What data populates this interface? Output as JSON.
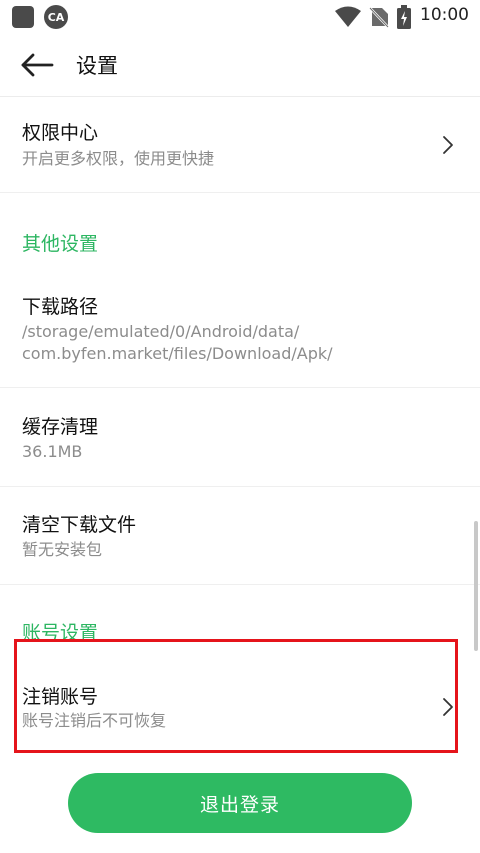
{
  "status_bar": {
    "time": "10:00",
    "left_badge_text": "CA"
  },
  "toolbar": {
    "title": "设置"
  },
  "items": [
    {
      "title": "权限中心",
      "subtitle": "开启更多权限，使用更快捷",
      "has_chevron": true
    },
    {
      "title": "下载路径",
      "subtitle_line1": "/storage/emulated/0/Android/data/",
      "subtitle_line2": "com.byfen.market/files/Download/Apk/"
    },
    {
      "title": "缓存清理",
      "subtitle": "36.1MB"
    },
    {
      "title": "清空下载文件",
      "subtitle": "暂无安装包"
    },
    {
      "title": "注销账号",
      "subtitle": "账号注销后不可恢复",
      "has_chevron": true
    }
  ],
  "sections": {
    "other": "其他设置",
    "account": "账号设置"
  },
  "logout_button": {
    "label": "退出登录"
  },
  "colors": {
    "accent": "#2db662",
    "button": "#2eba62",
    "highlight": "#e5141b"
  }
}
